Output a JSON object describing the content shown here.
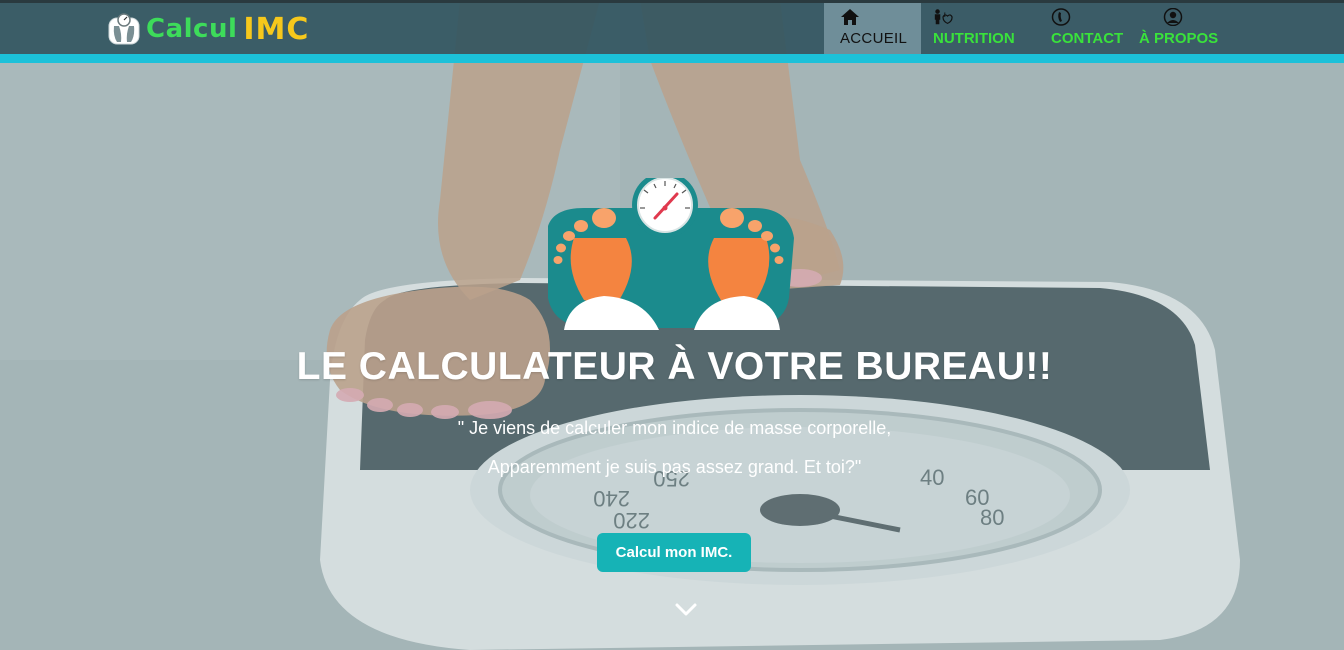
{
  "brand": {
    "part1": "Calcul",
    "part2": "IMC",
    "icon": "scale-logo-icon"
  },
  "nav": {
    "items": [
      {
        "label": "ACCUEIL",
        "icon": "home-icon",
        "active": true
      },
      {
        "label": "NUTRITION",
        "icon": "nutrition-icon",
        "active": false
      },
      {
        "label": "CONTACT",
        "icon": "phone-icon",
        "active": false
      },
      {
        "label": "À PROPOS",
        "icon": "user-icon",
        "active": false
      }
    ]
  },
  "hero": {
    "title": "LE CALCULATEUR À VOTRE BUREAU!!",
    "quote_line1": "\" Je viens de calculer mon indice de masse corporelle,",
    "quote_line2": "Apparemment je suis pas assez grand. Et toi?\"",
    "cta_label": "Calcul mon IMC.",
    "scroll_icon": "chevron-down-icon"
  },
  "colors": {
    "navbar": "#32555f",
    "accent_bar": "#1cc1d9",
    "brand_green": "#3ddc5a",
    "brand_yellow": "#f6c81c",
    "nav_link": "#39e23b",
    "cta": "#16b3b6"
  }
}
